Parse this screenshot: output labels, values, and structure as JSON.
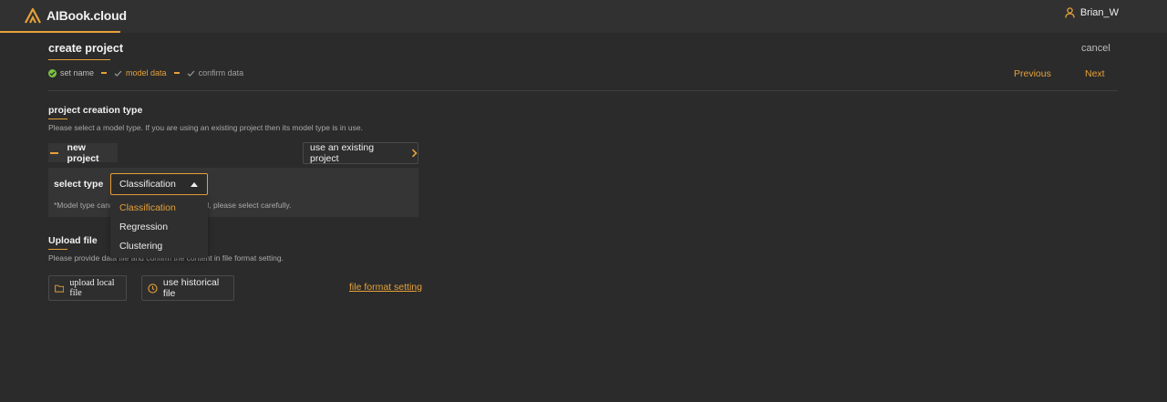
{
  "app": {
    "name": "AIBook.cloud",
    "user": "Brian_W"
  },
  "header": {
    "title": "create project",
    "cancel_label": "cancel"
  },
  "steps": [
    {
      "label": "set name",
      "state": "done"
    },
    {
      "label": "model data",
      "state": "active"
    },
    {
      "label": "confirm data",
      "state": "pending"
    }
  ],
  "nav": {
    "previous": "Previous",
    "next": "Next"
  },
  "creation_type": {
    "title": "project creation type",
    "description": "Please select a model type. If you are using an existing project then its model type is in use.",
    "new_project_label": "new project",
    "existing_project_label": "use an existing project",
    "select_type_label": "select type",
    "selected_value": "Classification",
    "note": "*Model type cann",
    "note_tail": "ect is created, please select carefully.",
    "options": [
      "Classification",
      "Regression",
      "Clustering"
    ]
  },
  "upload": {
    "title": "Upload file",
    "description": "Please provide data file and confirm the content in file format setting.",
    "local_label": "upload local file",
    "history_label": "use historical file",
    "format_link": "file format setting"
  },
  "colors": {
    "accent": "#e6a13a",
    "success": "#7cc242",
    "background": "#2b2b2b",
    "topbar": "#313131"
  }
}
